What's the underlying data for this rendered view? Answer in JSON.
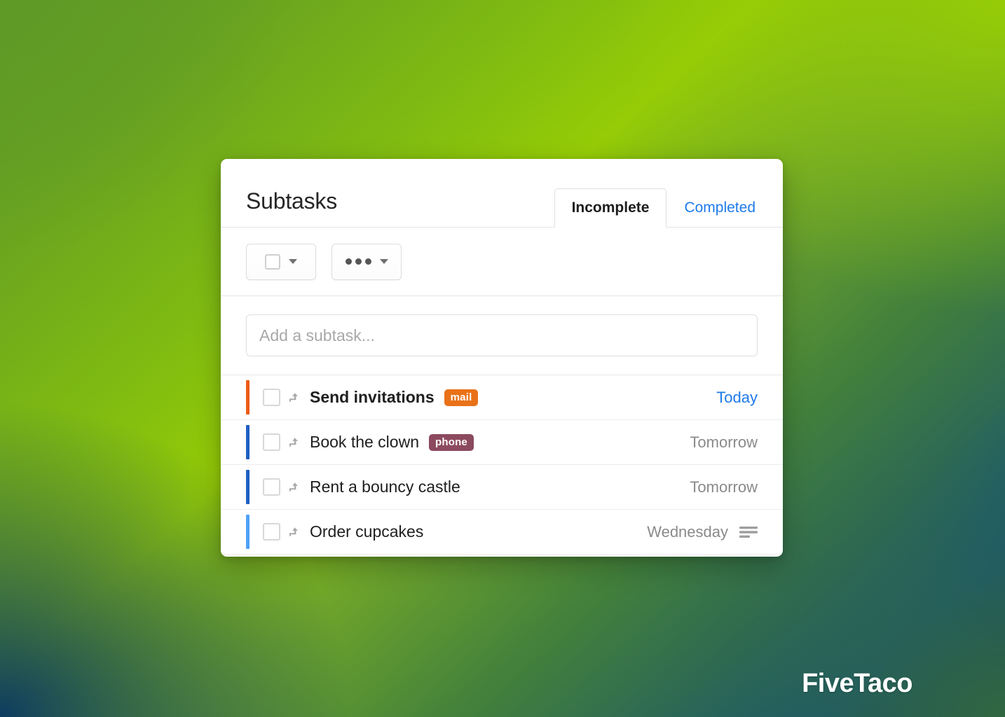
{
  "background": {
    "gradient_top_left": "#5f9a26",
    "gradient_top_right": "#95cc06",
    "gradient_bottom_left": "#0b3a63",
    "gradient_bottom_right": "#356b3e"
  },
  "card": {
    "title": "Subtasks",
    "tabs": [
      {
        "label": "Incomplete",
        "active": true
      },
      {
        "label": "Completed",
        "active": false
      }
    ],
    "toolbar": {
      "checkbox_dropdown": {
        "icon": "checkbox-icon",
        "caret": "chevron-down-icon"
      },
      "more_dropdown": {
        "icon": "ellipsis-icon",
        "caret": "chevron-down-icon"
      }
    },
    "add_subtask": {
      "placeholder": "Add a subtask...",
      "value": ""
    },
    "tasks": [
      {
        "name": "Send invitations",
        "bold": true,
        "bar_color": "#ec5b16",
        "tag": {
          "label": "mail",
          "color": "#e97219"
        },
        "due": "Today",
        "due_highlight": true,
        "has_notes": false
      },
      {
        "name": "Book the clown",
        "bold": false,
        "bar_color": "#1f5fc2",
        "tag": {
          "label": "phone",
          "color": "#8c4a5f"
        },
        "due": "Tomorrow",
        "due_highlight": false,
        "has_notes": false
      },
      {
        "name": "Rent a bouncy castle",
        "bold": false,
        "bar_color": "#1f5fc2",
        "tag": null,
        "due": "Tomorrow",
        "due_highlight": false,
        "has_notes": false
      },
      {
        "name": "Order cupcakes",
        "bold": false,
        "bar_color": "#4ea2f7",
        "tag": null,
        "due": "Wednesday",
        "due_highlight": false,
        "has_notes": true
      }
    ]
  },
  "brand": {
    "name": "FiveTaco"
  },
  "colors": {
    "accent_blue": "#1e7ae8",
    "tag_orange": "#e97219",
    "tag_maroon": "#8c4a5f",
    "bar_orange": "#ec5b16",
    "bar_blue_dark": "#1f5fc2",
    "bar_blue_light": "#4ea2f7"
  }
}
